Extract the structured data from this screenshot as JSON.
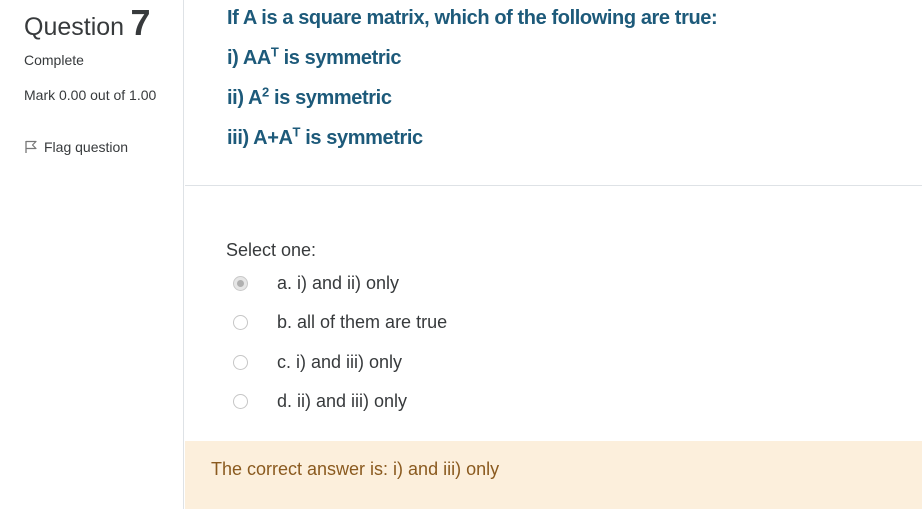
{
  "info": {
    "question_label": "Question",
    "question_number": "7",
    "state": "Complete",
    "grade": "Mark 0.00 out of 1.00",
    "flag_label": "Flag question",
    "flag_icon": "flag-icon"
  },
  "question": {
    "lines": [
      {
        "pre": "If A is a square matrix, which of the following are true:",
        "sup": "",
        "post": ""
      },
      {
        "pre": "i) AA",
        "sup": "T",
        "post": " is symmetric"
      },
      {
        "pre": "ii) A",
        "sup": "2",
        "post": " is symmetric"
      },
      {
        "pre": "iii) A+A",
        "sup": "T",
        "post": " is symmetric"
      }
    ]
  },
  "answer": {
    "prompt": "Select one:",
    "options": [
      {
        "label": "a. i) and ii) only",
        "selected": true
      },
      {
        "label": "b. all of them are true",
        "selected": false
      },
      {
        "label": "c. i) and iii) only",
        "selected": false
      },
      {
        "label": "d. ii) and iii) only",
        "selected": false
      }
    ]
  },
  "feedback": {
    "text": "The correct answer is: i) and iii) only"
  },
  "colors": {
    "question_text": "#1d5a7a",
    "feedback_bg": "#fcefdc",
    "feedback_text": "#8a5a1f"
  }
}
